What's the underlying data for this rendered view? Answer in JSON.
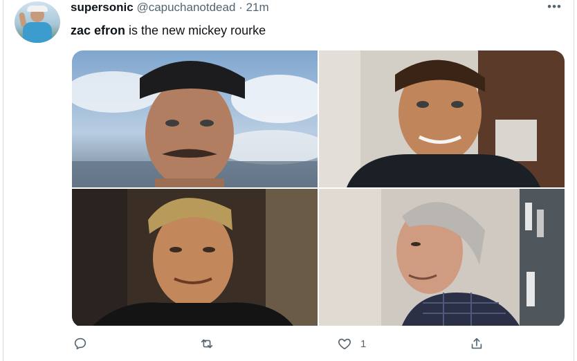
{
  "tweet": {
    "display_name": "supersonic",
    "handle": "@capuchanotdead",
    "separator": "·",
    "time": "21m",
    "text_bold": "zac efron",
    "text_rest": " is the new mickey rourke",
    "more_icon": "•••"
  },
  "media": {
    "photos": [
      {
        "name": "photo-zac-efron-sky"
      },
      {
        "name": "photo-zac-efron-indoor"
      },
      {
        "name": "photo-mickey-rourke-young"
      },
      {
        "name": "photo-mickey-rourke-old"
      }
    ]
  },
  "actions": {
    "reply_icon": "reply-icon",
    "retweet_icon": "retweet-icon",
    "like_icon": "heart-icon",
    "like_count": "1",
    "share_icon": "share-icon"
  },
  "colors": {
    "text_primary": "#0f1419",
    "text_secondary": "#536471",
    "border": "#d9d9d9"
  }
}
